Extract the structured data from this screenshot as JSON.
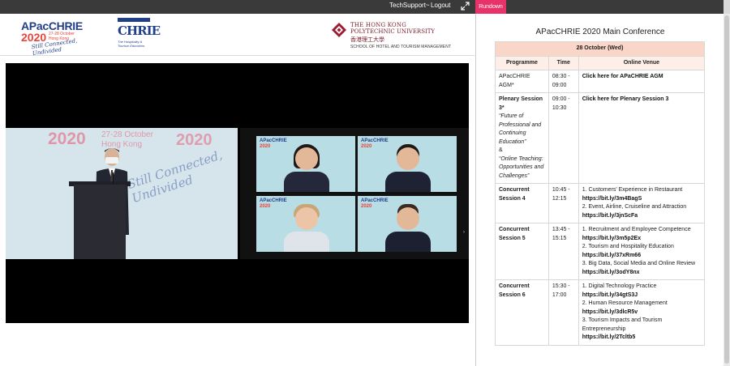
{
  "topbar": {
    "techsupport_label": "TechSupport~",
    "logout_label": "Logout",
    "rundown_label": "Rundown"
  },
  "logos": {
    "apacchrie": {
      "title": "APacCHRIE",
      "year": "2020",
      "dates": "27-28 October",
      "location": "Hong Kong",
      "tagline": "Still Connected, Undivided"
    },
    "chrie": {
      "name": "CHRIE",
      "subtitle": "The Hospitality & Tourism Educators"
    },
    "polyu": {
      "line1": "THE HONG KONG",
      "line2": "POLYTECHNIC UNIVERSITY",
      "chinese": "香港理工大學",
      "school": "SCHOOL OF HOTEL AND TOURISM MANAGEMENT"
    }
  },
  "video": {
    "stage_year": "2020",
    "stage_dates": "27-28 October",
    "stage_location": "Hong Kong",
    "stage_tagline": "Still Connected, Undivided",
    "tile_brand": "APacCHRIE",
    "tile_year": "2020"
  },
  "rundown": {
    "title": "APacCHRIE 2020 Main Conference",
    "date": "28 October (Wed)",
    "columns": [
      "Programme",
      "Time",
      "Online Venue"
    ],
    "rows": [
      {
        "programme": "APacCHRIE AGM*",
        "time": "08:30 - 09:00",
        "venue_link": "Click here for APaCHRIE AGM"
      },
      {
        "programme": "Plenary Session 3*",
        "topic1": "“Future of Professional and Continuing Education”",
        "amp": "&",
        "topic2": "“Online Teaching: Opportunities and Challenges”",
        "time": "09:00 - 10:30",
        "venue_link": "Click here for Plenary Session 3"
      },
      {
        "programme": "Concurrent Session 4",
        "time": "10:45 - 12:15",
        "items": [
          {
            "label": "1.  Customers' Experience in Restaurant",
            "url": "https://bit.ly/3m4BagS"
          },
          {
            "label": "2.  Event, Airline, Cruiseline and Attraction",
            "url": "https://bit.ly/3jnScFa"
          }
        ]
      },
      {
        "programme": "Concurrent Session 5",
        "time": "13:45 - 15:15",
        "items": [
          {
            "label": "1.  Recruitment and Employee Competence",
            "url": "https://bit.ly/3m5p2Ex"
          },
          {
            "label": "2.  Tourism and Hospitality Education",
            "url": "https://bit.ly/37xRm66"
          },
          {
            "label": "3.  Big Data, Social Media and Online Review",
            "url": "https://bit.ly/3odY8nx"
          }
        ]
      },
      {
        "programme": "Concurrent Session 6",
        "time": "15:30 - 17:00",
        "items": [
          {
            "label": "1.  Digital Technology Practice",
            "url": "https://bit.ly/34gtS3J"
          },
          {
            "label": "2.  Human Resource Management",
            "url": "https://bit.ly/3dlcR5v"
          },
          {
            "label": "3.  Tourism Impacts and Tourism Entrepreneurship",
            "url": "https://bit.ly/2Tcltb5"
          }
        ]
      }
    ]
  },
  "colors": {
    "topbar": "#3a3a3a",
    "accent": "#e8336a",
    "table_header": "#f9d6c8",
    "brand_blue": "#223f8a",
    "brand_red": "#e8443a"
  }
}
